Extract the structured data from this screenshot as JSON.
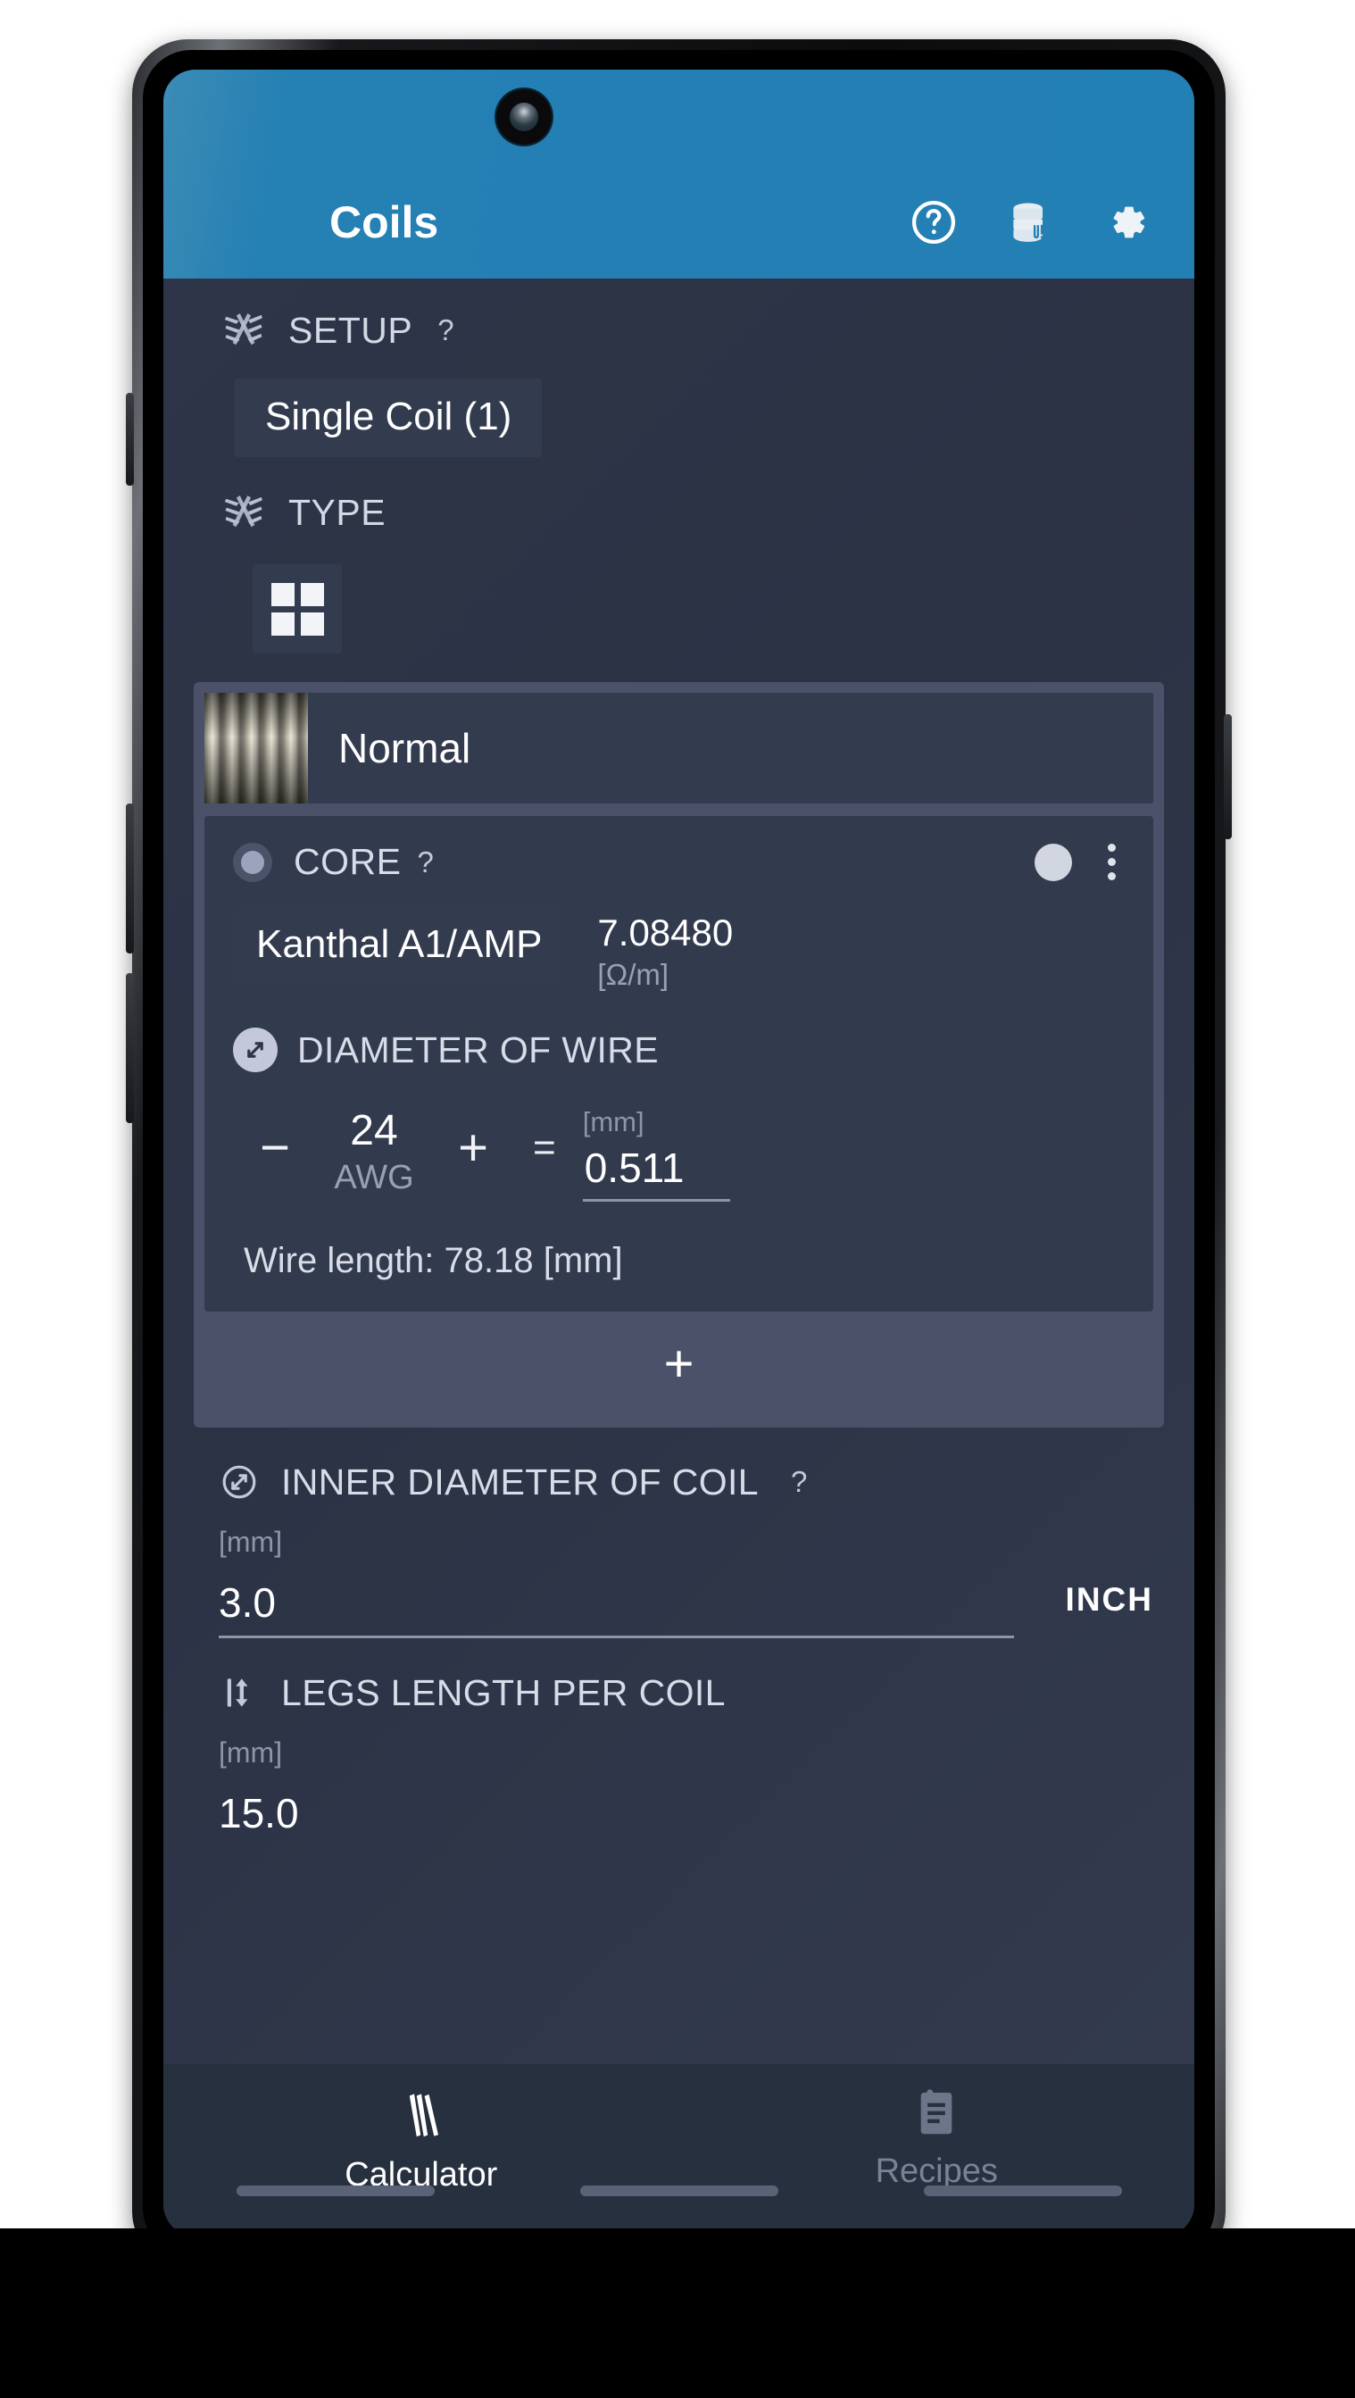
{
  "app": {
    "title": "Coils",
    "header_icons": [
      {
        "name": "help-circle-icon",
        "label": "Help"
      },
      {
        "name": "database-coil-icon",
        "label": "Database"
      },
      {
        "name": "gear-icon",
        "label": "Settings"
      }
    ]
  },
  "setup": {
    "icon": "twisted-wire-icon",
    "label": "SETUP",
    "help": "?",
    "selected": "Single Coil (1)"
  },
  "type": {
    "icon": "twisted-wire-icon",
    "label": "TYPE",
    "grid_button": "grid-icon"
  },
  "coil": {
    "name": "Normal",
    "thumbnail": "coil-photo-icon",
    "core": {
      "radio": "radio-selected-icon",
      "label": "CORE",
      "help": "?",
      "color_swatch": "color-circle-icon",
      "menu": "kebab-menu-icon",
      "material": "Kanthal A1/AMP",
      "resistance_value": "7.08480",
      "resistance_unit": "[Ω/m]"
    },
    "diameter": {
      "icon": "diameter-arrow-icon",
      "label": "DIAMETER OF WIRE",
      "minus": "−",
      "plus": "+",
      "gauge_value": "24",
      "gauge_unit": "AWG",
      "equals": "=",
      "mm_unit": "[mm]",
      "mm_value": "0.511"
    },
    "wire_length": "Wire length: 78.18 [mm]",
    "add_button": "+"
  },
  "inner_diameter": {
    "icon": "diameter-arrow-icon",
    "label": "INNER DIAMETER OF COIL",
    "help": "?",
    "unit": "[mm]",
    "value": "3.0",
    "inch_button": "INCH"
  },
  "legs_length": {
    "icon": "vertical-arrow-icon",
    "label": "LEGS LENGTH PER COIL",
    "unit": "[mm]",
    "value": "15.0"
  },
  "bottom_nav": [
    {
      "name": "tab-calculator",
      "icon": "coil-flame-icon",
      "label": "Calculator",
      "active": true
    },
    {
      "name": "tab-recipes",
      "icon": "clipboard-icon",
      "label": "Recipes",
      "active": false
    }
  ],
  "colors": {
    "appbar": "#2380b4",
    "background": "#2e3548",
    "card": "#4a5168",
    "panel": "#323a4e",
    "accent_text": "#ffffff",
    "muted_text": "#98a0b3",
    "nav_bar": "#27303f"
  }
}
